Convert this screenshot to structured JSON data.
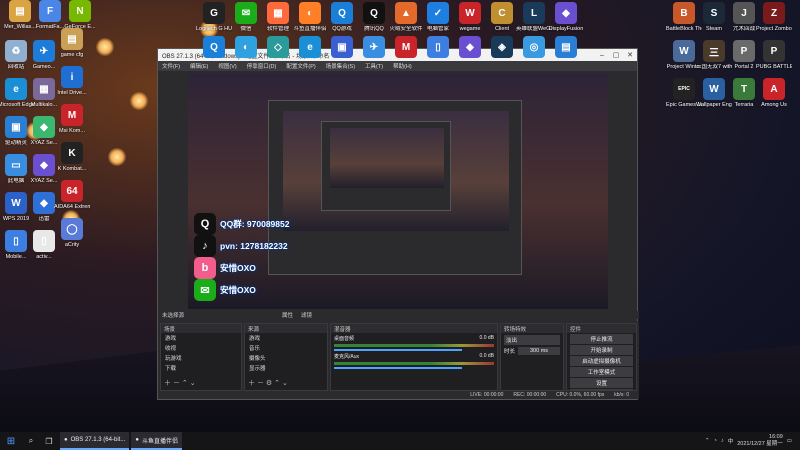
{
  "colors": {
    "accent": "#4da3ff",
    "obs_bg": "#2b2b2e",
    "taskbar": "#151518"
  },
  "desktop_left_top": [
    {
      "label": "Mer_Willas...",
      "icon": "folder-icon",
      "color": "#d9a441",
      "glyph": "▤"
    },
    {
      "label": "FormatFa...",
      "icon": "app-icon",
      "color": "#4a86e8",
      "glyph": "F"
    },
    {
      "label": "GeForce E...",
      "icon": "nvidia-icon",
      "color": "#76b900",
      "glyph": "N"
    }
  ],
  "desktop_left_col": [
    {
      "label": "回收站",
      "icon": "recycle-bin-icon",
      "color": "#8fb0d0",
      "glyph": "♻"
    },
    {
      "label": "Microsoft Edge",
      "icon": "edge-icon",
      "color": "#1b8fd6",
      "glyph": "e"
    },
    {
      "label": "驱动精灵",
      "icon": "driver-icon",
      "color": "#2a7fd4",
      "glyph": "▣"
    },
    {
      "label": "此电脑",
      "icon": "computer-icon",
      "color": "#3a8ee0",
      "glyph": "▭"
    },
    {
      "label": "WPS 2019",
      "icon": "wps-icon",
      "color": "#2b62c9",
      "glyph": "W"
    },
    {
      "label": "Mobile...",
      "icon": "mobile-icon",
      "color": "#3d7fe0",
      "glyph": "▯"
    }
  ],
  "desktop_left_col2": [
    {
      "label": "Gameo...",
      "icon": "game-icon",
      "color": "#1d7cd8",
      "glyph": "✈"
    },
    {
      "label": "Multikalo...",
      "icon": "app-icon",
      "color": "#7a6a9a",
      "glyph": "▦"
    },
    {
      "label": "XYAZ Se...",
      "icon": "xyaz-icon",
      "color": "#3bb870",
      "glyph": "◆"
    },
    {
      "label": "XYAZ Se...",
      "icon": "xyaz-icon",
      "color": "#6a4fd0",
      "glyph": "◆"
    },
    {
      "label": "迅雷",
      "icon": "thunder-icon",
      "color": "#2f6fd8",
      "glyph": "◆"
    },
    {
      "label": "activ...",
      "icon": "file-icon",
      "color": "#e8e8e8",
      "glyph": "▯"
    }
  ],
  "desktop_left_col3": [
    {
      "label": "game cfg",
      "icon": "folder-icon",
      "color": "#c9a055",
      "glyph": "▤"
    },
    {
      "label": "Intel Drive...",
      "icon": "intel-icon",
      "color": "#1f6ed4",
      "glyph": "i"
    },
    {
      "label": "Msi Kom...",
      "icon": "msi-icon",
      "color": "#c8242a",
      "glyph": "M"
    },
    {
      "label": "K Kombat...",
      "icon": "app-icon",
      "color": "#222",
      "glyph": "K"
    },
    {
      "label": "AIDA64 Extreme",
      "icon": "aida-icon",
      "color": "#c8242a",
      "glyph": "64"
    },
    {
      "label": "aCrity",
      "icon": "app-icon",
      "color": "#5a7ad8",
      "glyph": "◯"
    }
  ],
  "desktop_top_row": [
    {
      "label": "Logitech G HUB",
      "icon": "logitech-icon",
      "color": "#222",
      "glyph": "G"
    },
    {
      "label": "微信",
      "icon": "wechat-icon",
      "color": "#1aad19",
      "glyph": "✉"
    },
    {
      "label": "软件管理",
      "icon": "app-icon",
      "color": "#ff6a3d",
      "glyph": "▦"
    },
    {
      "label": "斗鱼直播伴侣",
      "icon": "douyu-icon",
      "color": "#ff7f27",
      "glyph": "◐"
    },
    {
      "label": "QQ游戏",
      "icon": "qq-game-icon",
      "color": "#1a7fd8",
      "glyph": "Q"
    },
    {
      "label": "腾讯QQ",
      "icon": "qq-icon",
      "color": "#111",
      "glyph": "Q"
    },
    {
      "label": "火绒安全软件",
      "icon": "huorong-icon",
      "color": "#e36a2a",
      "glyph": "▲"
    },
    {
      "label": "电脑管家",
      "icon": "guard-icon",
      "color": "#1f7fe0",
      "glyph": "✓"
    },
    {
      "label": "wegame",
      "icon": "wegame-icon",
      "color": "#c8242a",
      "glyph": "W"
    },
    {
      "label": "Client",
      "icon": "client-icon",
      "color": "#c09030",
      "glyph": "C"
    },
    {
      "label": "英雄联盟WeGame版",
      "icon": "lol-icon",
      "color": "#1a3a5a",
      "glyph": "L"
    },
    {
      "label": "DisplayFusion",
      "icon": "app-icon",
      "color": "#6a4fd0",
      "glyph": "◆"
    }
  ],
  "desktop_top_row2": [
    {
      "label": "",
      "icon": "app-icon",
      "color": "#1a7fd8",
      "glyph": "Q"
    },
    {
      "label": "",
      "icon": "app-icon",
      "color": "#2fa0e0",
      "glyph": "◐"
    },
    {
      "label": "",
      "icon": "app-icon",
      "color": "#2a9a9a",
      "glyph": "◇"
    },
    {
      "label": "",
      "icon": "app-icon",
      "color": "#1b8fd6",
      "glyph": "e"
    },
    {
      "label": "",
      "icon": "app-icon",
      "color": "#3a5fd0",
      "glyph": "▣"
    },
    {
      "label": "",
      "icon": "app-icon",
      "color": "#3a8ee0",
      "glyph": "✈"
    },
    {
      "label": "",
      "icon": "app-icon",
      "color": "#c8242a",
      "glyph": "M"
    },
    {
      "label": "",
      "icon": "app-icon",
      "color": "#3d7fe0",
      "glyph": "▯"
    },
    {
      "label": "",
      "icon": "app-icon",
      "color": "#6a4fd0",
      "glyph": "◆"
    },
    {
      "label": "",
      "icon": "app-icon",
      "color": "#1a3a5a",
      "glyph": "◈"
    },
    {
      "label": "",
      "icon": "app-icon",
      "color": "#3a9adf",
      "glyph": "◎"
    },
    {
      "label": "",
      "icon": "app-icon",
      "color": "#2a7fd4",
      "glyph": "▤"
    }
  ],
  "desktop_right": [
    {
      "label": "BattleBlock Theater",
      "icon": "game-icon",
      "color": "#c8582a",
      "glyph": "B"
    },
    {
      "label": "Steam",
      "icon": "steam-icon",
      "color": "#1b2838",
      "glyph": "S"
    },
    {
      "label": "咒术回战",
      "icon": "game-icon",
      "color": "#555",
      "glyph": "J"
    },
    {
      "label": "Project Zomboid",
      "icon": "game-icon",
      "color": "#7a1a1a",
      "glyph": "Z"
    },
    {
      "label": "Project Winter",
      "icon": "game-icon",
      "color": "#4a6a9a",
      "glyph": "W"
    },
    {
      "label": "三国无双7 with...",
      "icon": "game-icon",
      "color": "#4a3a2a",
      "glyph": "三"
    },
    {
      "label": "Portal 2",
      "icon": "portal-icon",
      "color": "#6a6a6a",
      "glyph": "P"
    },
    {
      "label": "PUBG BATTLEGR...",
      "icon": "pubg-icon",
      "color": "#333",
      "glyph": "P"
    },
    {
      "label": "Epic Games Launcher",
      "icon": "epic-icon",
      "color": "#222",
      "glyph": "EPIC"
    },
    {
      "label": "Wallpaper Engine",
      "icon": "wallpaper-icon",
      "color": "#2a5fa0",
      "glyph": "W"
    },
    {
      "label": "Terraria",
      "icon": "terraria-icon",
      "color": "#3a7a3a",
      "glyph": "T"
    },
    {
      "label": "Among Us",
      "icon": "among-us-icon",
      "color": "#c8242a",
      "glyph": "A"
    }
  ],
  "overlay": [
    {
      "icon": "qq-icon",
      "color": "#111",
      "glyph": "Q",
      "text": "QQ群: 970089852"
    },
    {
      "icon": "tiktok-icon",
      "color": "#111",
      "glyph": "♪",
      "text": "pvn: 1278182232"
    },
    {
      "icon": "bilibili-icon",
      "color": "#f25d8e",
      "glyph": "b",
      "text": "安惜OXO"
    },
    {
      "icon": "weibo-icon",
      "color": "#1aad19",
      "glyph": "✉",
      "text": "安惜OXO"
    }
  ],
  "obs": {
    "title": "OBS 27.1.3 (64-bit, windows) - 配置文件: 未命名 - 场景: 未命名",
    "menu": [
      "文件(F)",
      "编辑(E)",
      "视图(V)",
      "停靠窗口(D)",
      "配置文件(P)",
      "场景集合(S)",
      "工具(T)",
      "帮助(H)"
    ],
    "toolbar_label": "未选择源",
    "toolbar_prop": "属性",
    "toolbar_filter": "滤镜",
    "dock_scene": "场景",
    "dock_source": "来源",
    "dock_mixer": "混音器",
    "dock_transition": "转场特效",
    "dock_controls": "控件",
    "scenes": [
      "游戏",
      "收视",
      "玩游戏",
      "下载"
    ],
    "sources": [
      "游戏",
      "音乐",
      "摄像头",
      "显示器"
    ],
    "mixer": [
      {
        "name": "桌面音频",
        "db": "0.0 dB"
      },
      {
        "name": "麦克风/Aux",
        "db": "0.0 dB"
      }
    ],
    "transition_type": "淡出",
    "duration_label": "时长",
    "duration_value": "300 ms",
    "controls": [
      "停止推流",
      "开始录制",
      "启动虚拟摄像机",
      "工作室模式",
      "设置",
      "退出"
    ],
    "status": [
      "LIVE: 00:00:00",
      "REC: 00:00:00",
      "CPU: 0.0%, 60.00 fps",
      "kb/s: 0"
    ]
  },
  "taskbar": {
    "apps": [
      {
        "icon": "obs-icon",
        "label": "OBS 27.1.3 (64-bit..."
      },
      {
        "icon": "douyu-icon",
        "label": "斗鱼直播伴侣"
      }
    ],
    "time": "16:09",
    "date": "2021/12/27 星期一",
    "lang": "中"
  }
}
